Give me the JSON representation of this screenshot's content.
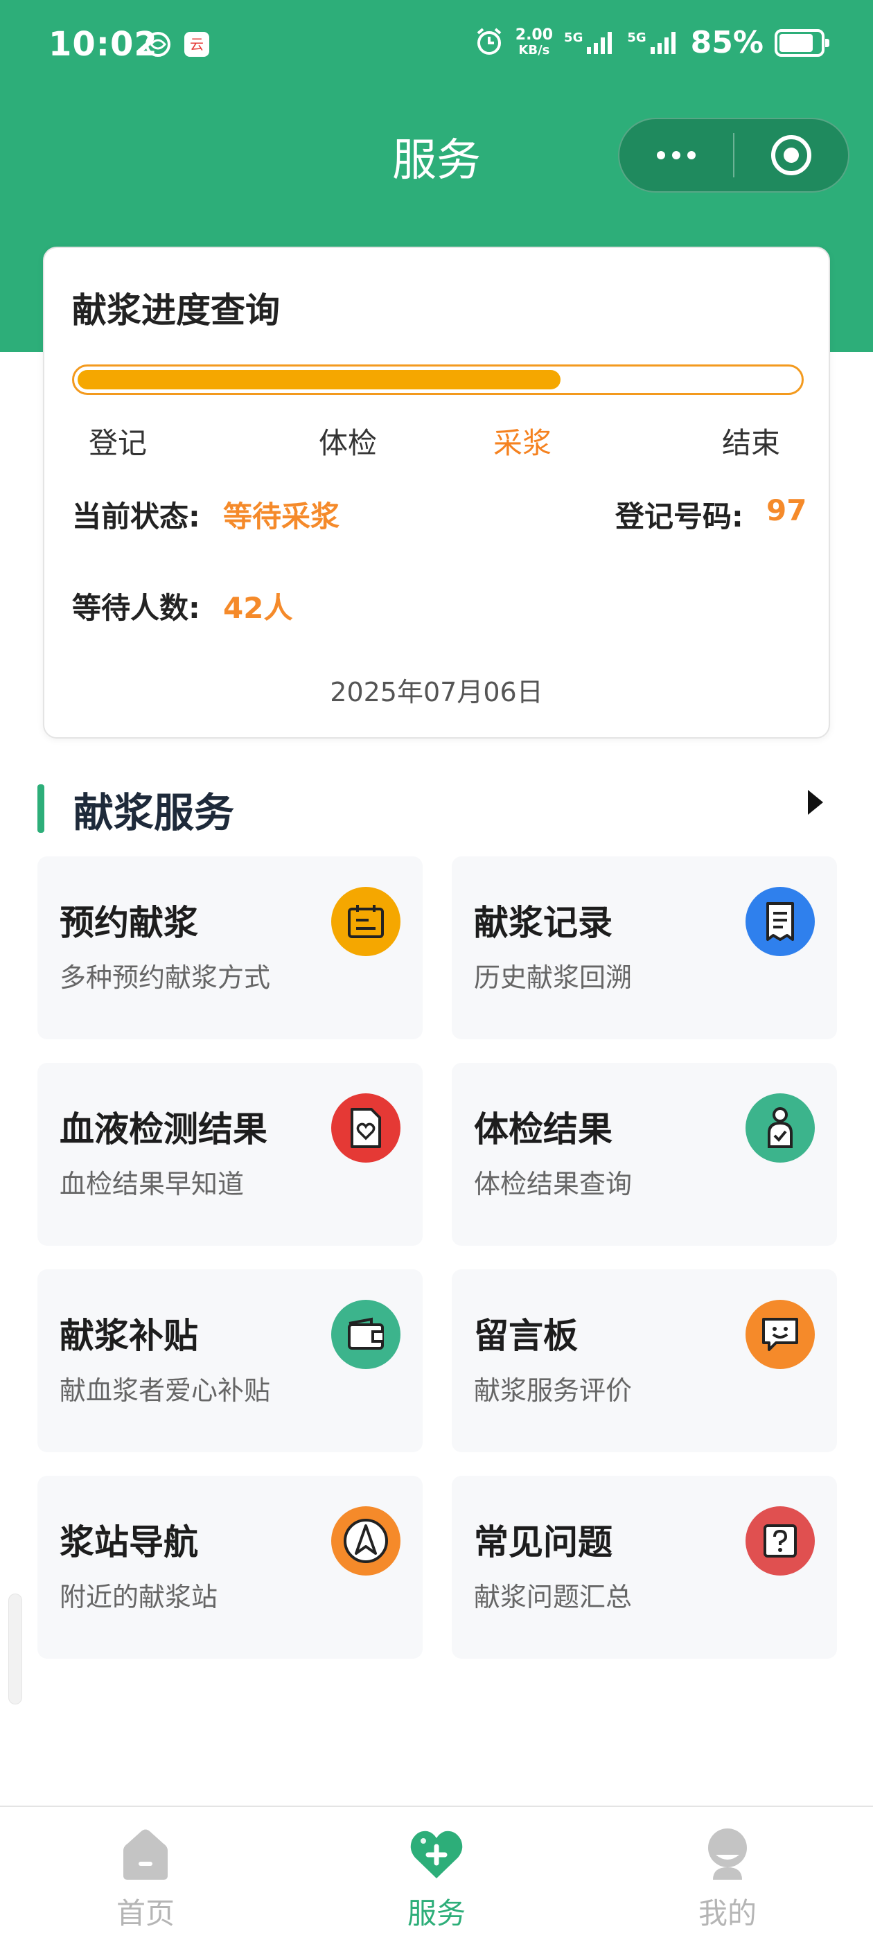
{
  "status_bar": {
    "time": "10:02",
    "net_speed_value": "2.00",
    "net_speed_unit": "KB/s",
    "sim1_tag": "5G",
    "sim2_tag": "5G",
    "battery_pct": "85%",
    "battery_level": 0.85
  },
  "header": {
    "title": "服务"
  },
  "progress_card": {
    "title": "献浆进度查询",
    "progress": 0.67,
    "steps": [
      "登记",
      "体检",
      "采浆",
      "结束"
    ],
    "active_step": 2,
    "status_label": "当前状态:",
    "status_value": "等待采浆",
    "reg_label": "登记号码:",
    "reg_value": "97",
    "waiting_label": "等待人数:",
    "waiting_value": "42人",
    "date": "2025年07月06日"
  },
  "services": {
    "title": "献浆服务",
    "items": [
      {
        "title": "预约献浆",
        "subtitle": "多种预约献浆方式",
        "icon": "calendar-icon",
        "color": "#f5a700"
      },
      {
        "title": "献浆记录",
        "subtitle": "历史献浆回溯",
        "icon": "receipt-icon",
        "color": "#2f80ed"
      },
      {
        "title": "血液检测结果",
        "subtitle": "血检结果早知道",
        "icon": "heart-document-icon",
        "color": "#e53935"
      },
      {
        "title": "体检结果",
        "subtitle": "体检结果查询",
        "icon": "person-check-icon",
        "color": "#3cb48c"
      },
      {
        "title": "献浆补贴",
        "subtitle": "献血浆者爱心补贴",
        "icon": "wallet-icon",
        "color": "#3cb48c"
      },
      {
        "title": "留言板",
        "subtitle": "献浆服务评价",
        "icon": "message-smile-icon",
        "color": "#f58a2a"
      },
      {
        "title": "浆站导航",
        "subtitle": "附近的献浆站",
        "icon": "navigation-icon",
        "color": "#f58a2a"
      },
      {
        "title": "常见问题",
        "subtitle": "献浆问题汇总",
        "icon": "question-icon",
        "color": "#e05050"
      }
    ]
  },
  "tabbar": {
    "items": [
      {
        "label": "首页",
        "icon": "home-icon",
        "active": false
      },
      {
        "label": "服务",
        "icon": "heart-plus-icon",
        "active": true
      },
      {
        "label": "我的",
        "icon": "user-icon",
        "active": false
      }
    ]
  },
  "colors": {
    "brand_green": "#2dae79",
    "accent_orange": "#f58a2a",
    "progress_fill": "#f5a700"
  }
}
